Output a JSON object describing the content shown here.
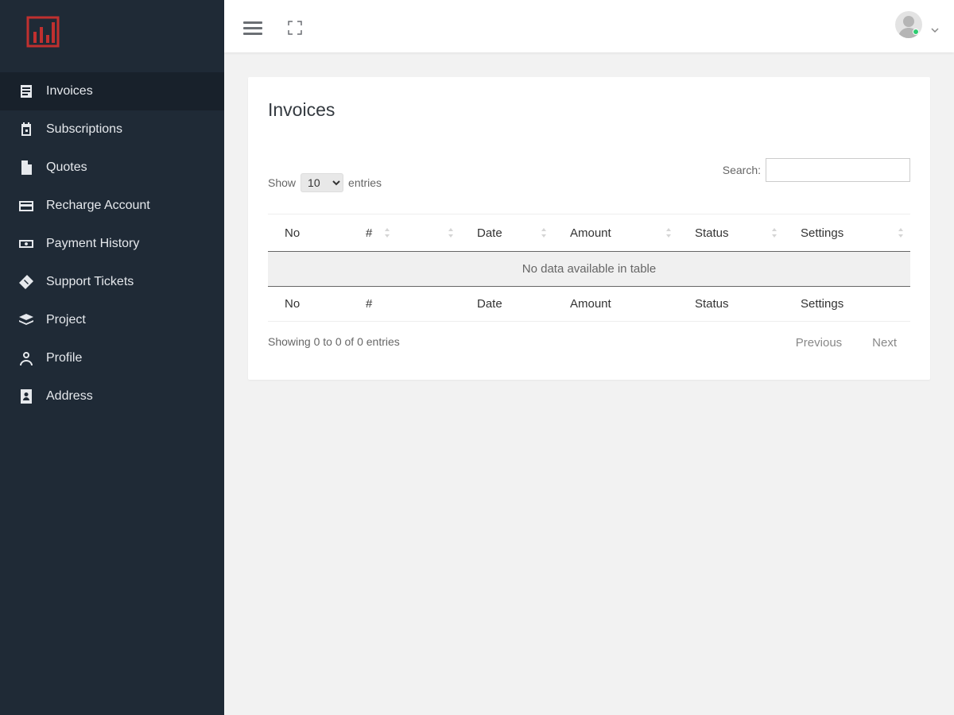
{
  "sidebar": {
    "items": [
      {
        "label": "Invoices",
        "icon": "invoice-icon",
        "active": true
      },
      {
        "label": "Subscriptions",
        "icon": "calendar-icon"
      },
      {
        "label": "Quotes",
        "icon": "document-icon"
      },
      {
        "label": "Recharge Account",
        "icon": "credit-card-icon"
      },
      {
        "label": "Payment History",
        "icon": "money-icon"
      },
      {
        "label": "Support Tickets",
        "icon": "ticket-icon"
      },
      {
        "label": "Project",
        "icon": "layers-icon"
      },
      {
        "label": "Profile",
        "icon": "user-icon"
      },
      {
        "label": "Address",
        "icon": "address-book-icon"
      }
    ]
  },
  "topbar": {
    "menu_icon": "hamburger-icon",
    "expand_icon": "fullscreen-icon",
    "status_color": "#2ecc71"
  },
  "card": {
    "title": "Invoices"
  },
  "table_controls": {
    "show_label": "Show",
    "length_value": "10",
    "entries_label": "entries",
    "search_label": "Search:",
    "search_value": ""
  },
  "table": {
    "headers": [
      "No",
      "#",
      "",
      "Date",
      "Amount",
      "Status",
      "Settings"
    ],
    "footers": [
      "No",
      "#",
      "",
      "Date",
      "Amount",
      "Status",
      "Settings"
    ],
    "empty_message": "No data available in table"
  },
  "footer": {
    "info": "Showing 0 to 0 of 0 entries",
    "previous": "Previous",
    "next": "Next"
  }
}
